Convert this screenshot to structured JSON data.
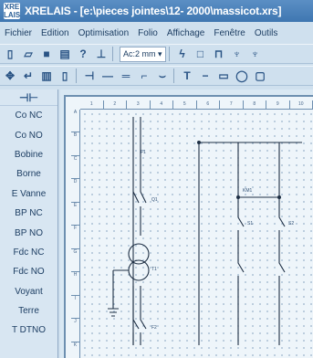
{
  "titlebar": {
    "app_icon_text": "XRE LAIS",
    "title": "XRELAIS - [e:\\pieces jointes\\12- 2000\\massicot.xrs]"
  },
  "menubar": {
    "items": [
      "Fichier",
      "Edition",
      "Optimisation",
      "Folio",
      "Affichage",
      "Fenêtre",
      "Outils"
    ]
  },
  "toolbar1": {
    "zoom_value": "Ac:2 mm ▾"
  },
  "sidebar": {
    "head_icon": "contact-symbol-icon",
    "items": [
      "Co NC",
      "Co NO",
      "Bobine",
      "Borne",
      "E Vanne",
      "BP NC",
      "BP NO",
      "Fdc NC",
      "Fdc NO",
      "Voyant",
      "Terre",
      "T DTNO"
    ]
  },
  "drawing": {
    "column_refs": [
      "1",
      "2",
      "3",
      "4",
      "5",
      "6",
      "7",
      "8",
      "9",
      "10"
    ],
    "row_refs": [
      "A",
      "B",
      "C",
      "D",
      "E",
      "F",
      "G",
      "H",
      "I",
      "J",
      "K"
    ],
    "labels": {
      "q1": "Q1",
      "f1": "F1",
      "t1": "T1",
      "f2": "F2",
      "s1": "S1",
      "s2": "S2",
      "km1": "KM1"
    }
  },
  "colors": {
    "titlebar": "#3f77b1",
    "background": "#cfe0ee",
    "wire": "#1e2f44"
  }
}
